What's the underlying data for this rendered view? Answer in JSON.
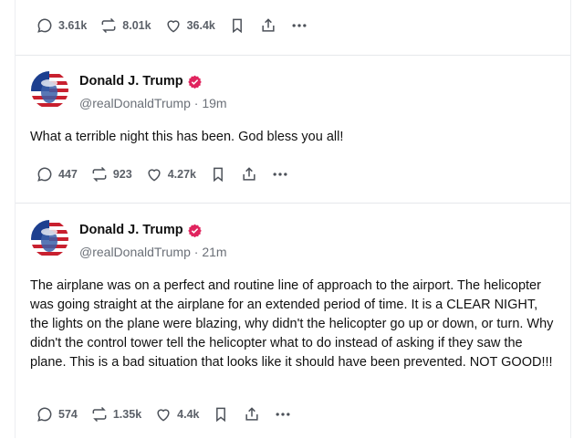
{
  "colors": {
    "verified_badge": "#e0245e",
    "divider": "#e6e8eb",
    "action_icon": "#4c5159",
    "meta_text": "#6b7078"
  },
  "posts": [
    {
      "partial": true,
      "stats": {
        "replies": "3.61k",
        "reposts": "8.01k",
        "likes": "36.4k"
      }
    },
    {
      "author": {
        "name": "Donald J. Trump",
        "handle": "@realDonaldTrump",
        "time": "19m",
        "verified": true
      },
      "text": "What a terrible night this has been. God bless you all!",
      "stats": {
        "replies": "447",
        "reposts": "923",
        "likes": "4.27k"
      }
    },
    {
      "author": {
        "name": "Donald J. Trump",
        "handle": "@realDonaldTrump",
        "time": "21m",
        "verified": true
      },
      "text": "The airplane was on a perfect and routine line of approach to the airport. The helicopter was going straight at the airplane for an extended period of time. It is a CLEAR NIGHT, the lights on the plane were blazing, why didn't the helicopter go up or down, or turn. Why didn't the control tower tell the helicopter what to do instead of asking if they saw the plane. This is a bad situation that looks like it should have been prevented. NOT GOOD!!!",
      "stats": {
        "replies": "574",
        "reposts": "1.35k",
        "likes": "4.4k"
      }
    }
  ],
  "icons": [
    "reply-icon",
    "repost-icon",
    "heart-icon",
    "bookmark-icon",
    "share-icon",
    "more-icon",
    "verified-icon"
  ]
}
